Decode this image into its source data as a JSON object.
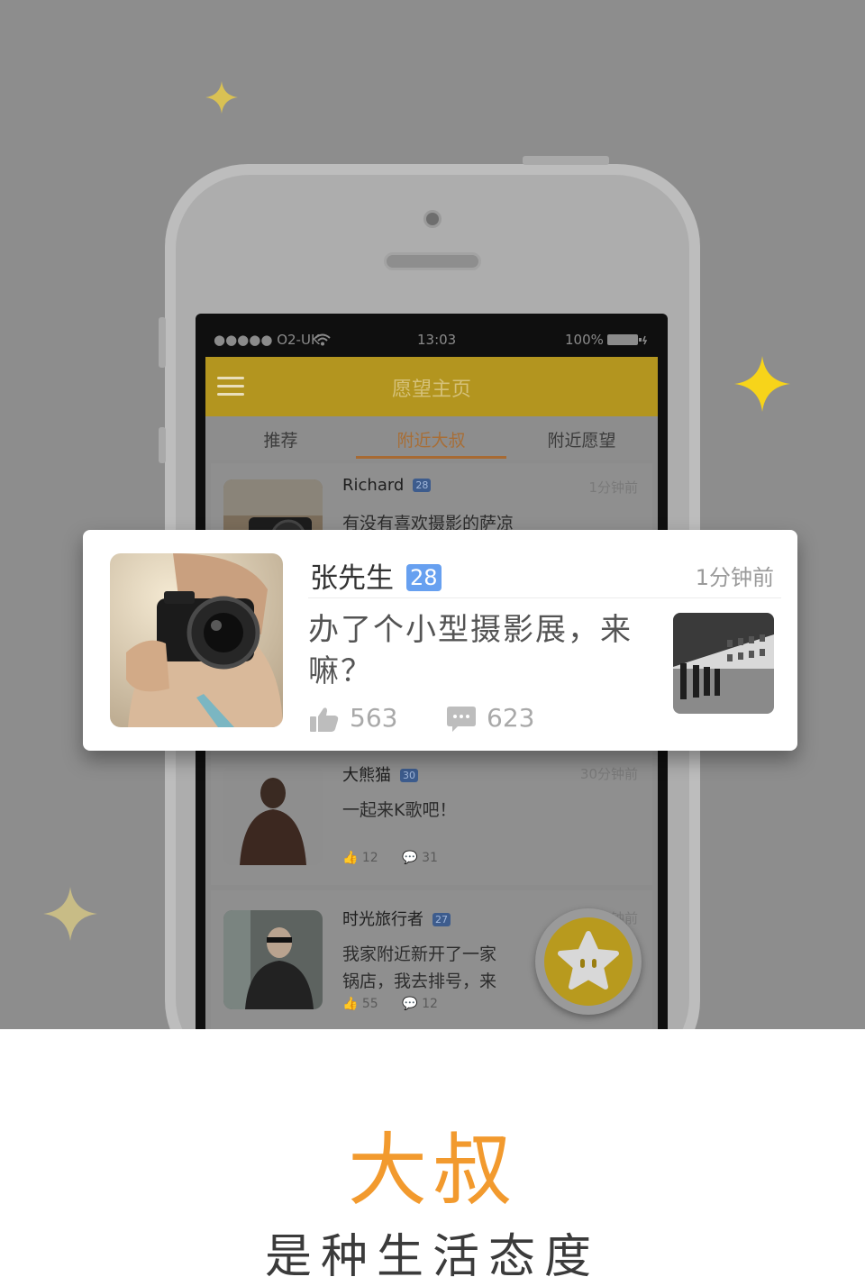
{
  "status_bar": {
    "carrier": "●●●●● O2-UK",
    "time": "13:03",
    "battery": "100%"
  },
  "app": {
    "title": "愿望主页",
    "tabs": [
      {
        "label": "推荐",
        "active": false
      },
      {
        "label": "附近大叔",
        "active": true
      },
      {
        "label": "附近愿望",
        "active": false
      }
    ],
    "feed": [
      {
        "name": "Richard",
        "age": "28",
        "time": "1分钟前",
        "message": "有没有喜欢摄影的萨凉",
        "likes": "",
        "comments": ""
      },
      {
        "name": "大熊猫",
        "age": "30",
        "time": "30分钟前",
        "message": "一起来K歌吧！",
        "likes": "12",
        "comments": "31"
      },
      {
        "name": "时光旅行者",
        "age": "27",
        "time": "钟前",
        "message": "我家附近新开了一家",
        "message2": "锅店，我去排号，来",
        "likes": "55",
        "comments": "12"
      }
    ]
  },
  "highlight_card": {
    "name": "张先生",
    "age": "28",
    "time": "1分钟前",
    "message": "办了个小型摄影展，来嘛？",
    "likes": "563",
    "comments": "623"
  },
  "headline": "大叔",
  "subline": "是种生活态度",
  "colors": {
    "accent": "#f29a2e",
    "badge": "#67a0f0",
    "title_bar": "#f5c82a"
  },
  "icons": [
    "menu-icon",
    "wifi-icon",
    "battery-icon",
    "thumbs-up-icon",
    "comment-icon",
    "star-mascot-icon",
    "sparkle-icon"
  ]
}
